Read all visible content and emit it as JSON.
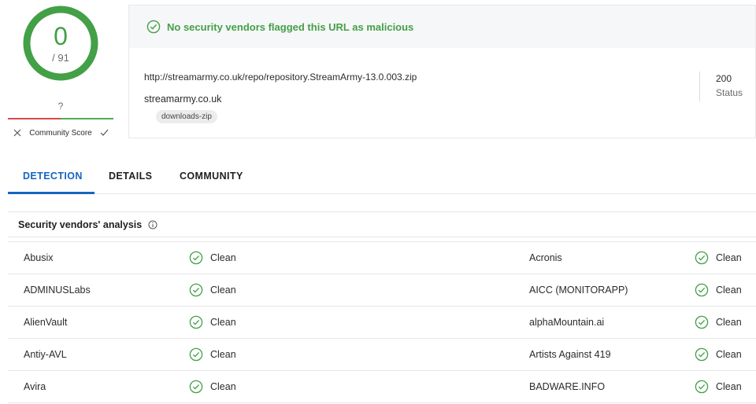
{
  "score": {
    "detections": "0",
    "total": "/ 91",
    "color": "#43a047"
  },
  "community": {
    "question": "?",
    "label": "Community Score"
  },
  "banner": {
    "text": "No security vendors flagged this URL as malicious",
    "color": "#43a047"
  },
  "resource": {
    "url": "http://streamarmy.co.uk/repo/repository.StreamArmy-13.0.003.zip",
    "host": "streamarmy.co.uk",
    "tag": "downloads-zip",
    "status_code": "200",
    "status_label": "Status"
  },
  "tabs": [
    {
      "label": "DETECTION",
      "active": true
    },
    {
      "label": "DETAILS",
      "active": false
    },
    {
      "label": "COMMUNITY",
      "active": false
    }
  ],
  "vendors": {
    "title": "Security vendors' analysis",
    "rows": [
      {
        "left": {
          "name": "Abusix",
          "result": "Clean"
        },
        "right": {
          "name": "Acronis",
          "result": "Clean"
        }
      },
      {
        "left": {
          "name": "ADMINUSLabs",
          "result": "Clean"
        },
        "right": {
          "name": "AICC (MONITORAPP)",
          "result": "Clean"
        }
      },
      {
        "left": {
          "name": "AlienVault",
          "result": "Clean"
        },
        "right": {
          "name": "alphaMountain.ai",
          "result": "Clean"
        }
      },
      {
        "left": {
          "name": "Antiy-AVL",
          "result": "Clean"
        },
        "right": {
          "name": "Artists Against 419",
          "result": "Clean"
        }
      },
      {
        "left": {
          "name": "Avira",
          "result": "Clean"
        },
        "right": {
          "name": "BADWARE.INFO",
          "result": "Clean"
        }
      }
    ]
  },
  "colors": {
    "accent_blue": "#1565c0",
    "clean_green": "#43a047",
    "negative_red": "#d84a4a"
  }
}
